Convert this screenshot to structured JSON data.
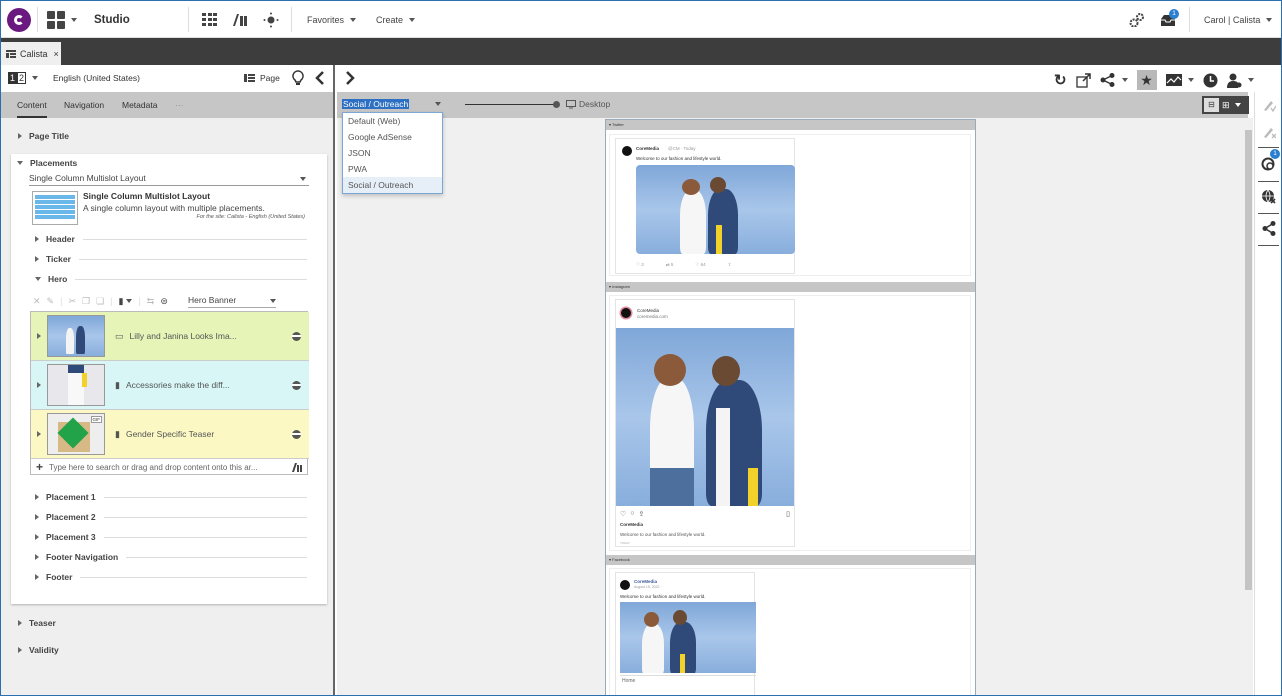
{
  "topbar": {
    "app_name": "Studio",
    "favorites_label": "Favorites",
    "create_label": "Create",
    "notification_count": "1",
    "user_label": "Carol | Calista"
  },
  "tabs": [
    {
      "label": "Calista"
    }
  ],
  "left_panel": {
    "locale": "English (United States)",
    "version_label": "12",
    "page_label": "Page",
    "tabs": [
      "Content",
      "Navigation",
      "Metadata",
      "···"
    ],
    "page_title_section": "Page Title",
    "placements_section": "Placements",
    "layout_select": "Single Column Multislot Layout",
    "layout_title": "Single Column Multislot Layout",
    "layout_desc": "A single column layout with multiple placements.",
    "layout_site": "For the site: Calista - English (United States)",
    "slots": [
      "Header",
      "Ticker",
      "Hero",
      "Placement 1",
      "Placement 2",
      "Placement 3",
      "Footer Navigation",
      "Footer"
    ],
    "hero_view_type": "Hero Banner",
    "hero_items": [
      {
        "title": "Lilly and Janina Looks Ima...",
        "color": "#e6f4b8"
      },
      {
        "title": "Accessories make the diff...",
        "color": "#d8f6f6"
      },
      {
        "title": "Gender Specific Teaser",
        "color": "#fbf8c4",
        "badge": "GIF"
      }
    ],
    "drop_placeholder": "Type here to search or drag and drop content onto this ar...",
    "teaser_section": "Teaser",
    "validity_section": "Validity"
  },
  "main": {
    "preview_channel": "Social / Outreach",
    "channel_options": [
      "Default (Web)",
      "Google AdSense",
      "JSON",
      "PWA",
      "Social / Outreach"
    ],
    "device_label": "Desktop",
    "channels": [
      {
        "name": "Twitter",
        "author": "CoreMedia",
        "handle": "@CM · Today",
        "text": "Welcome to our fashion and lifestyle world.",
        "stats": [
          "3",
          "5",
          "64",
          ""
        ]
      },
      {
        "name": "Instagram",
        "author": "CoreMedia",
        "handle": "coremedia.com",
        "caption_author": "CoreMedia",
        "text": "Welcome to our fashion and lifestyle world.",
        "meta": "TODAY"
      },
      {
        "name": "Facebook",
        "author": "CoreMedia",
        "handle": "August 15, 2022 ·",
        "text": "Welcome to our fashion and lifestyle world.",
        "footer": "Home"
      }
    ]
  },
  "right_rail": {
    "notification_count": "1"
  }
}
